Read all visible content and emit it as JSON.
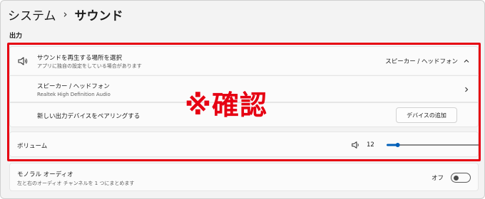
{
  "breadcrumb": {
    "parent": "システム",
    "separator": "›",
    "current": "サウンド"
  },
  "output_section": {
    "label": "出力",
    "choose_output": {
      "title": "サウンドを再生する場所を選択",
      "subtitle": "アプリに独自の設定をしている場合があります",
      "selected": "スピーカー / ヘッドフォン"
    },
    "speaker_device": {
      "title": "スピーカー / ヘッドフォン",
      "subtitle": "Realtek High Definition Audio"
    },
    "pair_device": {
      "title": "新しい出力デバイスをペアリングする",
      "button_label": "デバイスの追加"
    },
    "volume": {
      "title": "ボリューム",
      "value": "12",
      "fraction": 0.12
    },
    "mono_audio": {
      "title": "モノラル オーディオ",
      "subtitle": "左と右のオーディオ チャンネルを 1 つにまとめます",
      "state_label": "オフ",
      "enabled": false
    }
  },
  "annotation": {
    "stamp_text": "※確認",
    "color": "#e60012"
  },
  "colors": {
    "accent": "#005fb8",
    "track": "#8a8a8a"
  }
}
